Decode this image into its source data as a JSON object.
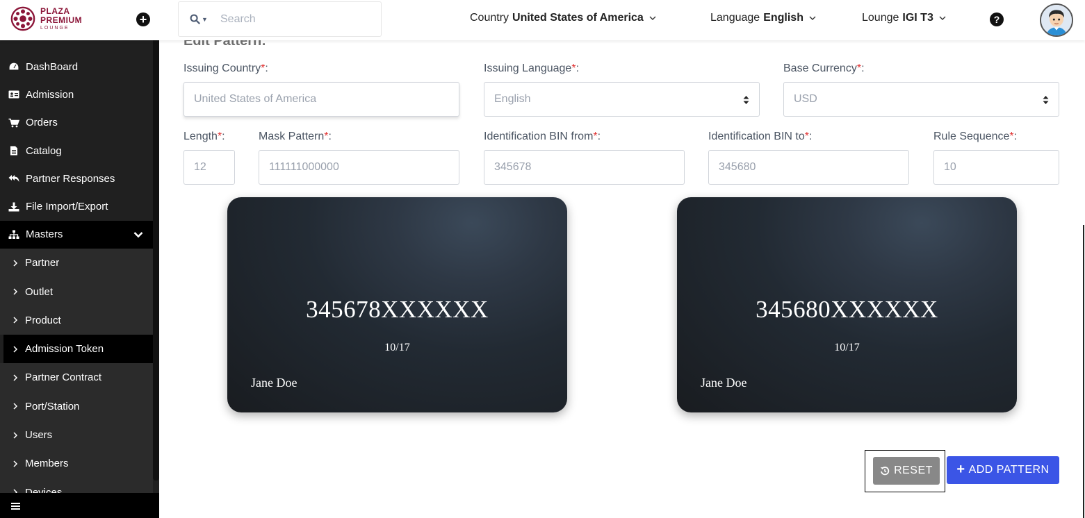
{
  "header": {
    "logo": {
      "line1": "PLAZA",
      "line2": "PREMIUM",
      "line3": "LOUNGE",
      "color": "#8b1538"
    },
    "search_placeholder": "Search",
    "country": {
      "label": "Country",
      "value": "United States of America"
    },
    "language": {
      "label": "Language",
      "value": "English"
    },
    "lounge": {
      "label": "Lounge",
      "value": "IGI T3"
    },
    "help_symbol": "?",
    "add_symbol": "+"
  },
  "sidebar": {
    "items": [
      {
        "label": "DashBoard",
        "icon": "dashboard-icon"
      },
      {
        "label": "Admission",
        "icon": "id-card-icon"
      },
      {
        "label": "Orders",
        "icon": "cart-icon"
      },
      {
        "label": "Catalog",
        "icon": "file-icon"
      },
      {
        "label": "Partner Responses",
        "icon": "reply-all-icon"
      },
      {
        "label": "File Import/Export",
        "icon": "download-icon"
      },
      {
        "label": "Masters",
        "icon": "sitemap-icon"
      }
    ],
    "sub_items": [
      {
        "label": "Partner"
      },
      {
        "label": "Outlet"
      },
      {
        "label": "Product"
      },
      {
        "label": "Admission Token",
        "active": true
      },
      {
        "label": "Partner Contract"
      },
      {
        "label": "Port/Station"
      },
      {
        "label": "Users"
      },
      {
        "label": "Members"
      },
      {
        "label": "Devices"
      }
    ]
  },
  "form": {
    "title": "Edit Pattern:",
    "required_mark": "*",
    "issuing_country": {
      "label": "Issuing Country",
      "value": "United States of America"
    },
    "issuing_language": {
      "label": "Issuing Language",
      "value": "English"
    },
    "base_currency": {
      "label": "Base Currency",
      "value": "USD"
    },
    "length": {
      "label": "Length",
      "value": "12"
    },
    "mask_pattern": {
      "label": "Mask Pattern",
      "value": "111111000000"
    },
    "bin_from": {
      "label": "Identification BIN from",
      "value": "345678"
    },
    "bin_to": {
      "label": "Identification BIN to",
      "value": "345680"
    },
    "rule_sequence": {
      "label": "Rule Sequence",
      "value": "10"
    }
  },
  "cards": [
    {
      "number": "345678XXXXXX",
      "expiry": "10/17",
      "holder": "Jane Doe"
    },
    {
      "number": "345680XXXXXX",
      "expiry": "10/17",
      "holder": "Jane Doe"
    }
  ],
  "actions": {
    "reset_label": "RESET",
    "add_label": "ADD PATTERN",
    "add_color": "#3b55e6",
    "reset_color": "#888888"
  }
}
